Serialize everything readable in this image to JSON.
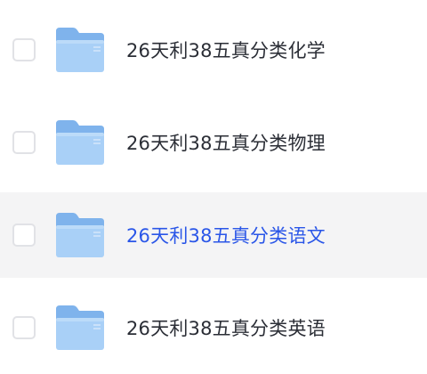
{
  "files": [
    {
      "name": "26天利38五真分类化学",
      "icon": "folder-icon",
      "checked": false,
      "hovered": false
    },
    {
      "name": "26天利38五真分类物理",
      "icon": "folder-icon",
      "checked": false,
      "hovered": false
    },
    {
      "name": "26天利38五真分类语文",
      "icon": "folder-icon",
      "checked": false,
      "hovered": true
    },
    {
      "name": "26天利38五真分类英语",
      "icon": "folder-icon",
      "checked": false,
      "hovered": false
    }
  ],
  "colors": {
    "text": "#2b2e36",
    "hover_text": "#2a56e8",
    "hover_background": "#f4f4f5",
    "folder_light": "#a9d0f7",
    "folder_dark": "#7fb3ec",
    "checkbox_border": "#e1e2e6"
  }
}
